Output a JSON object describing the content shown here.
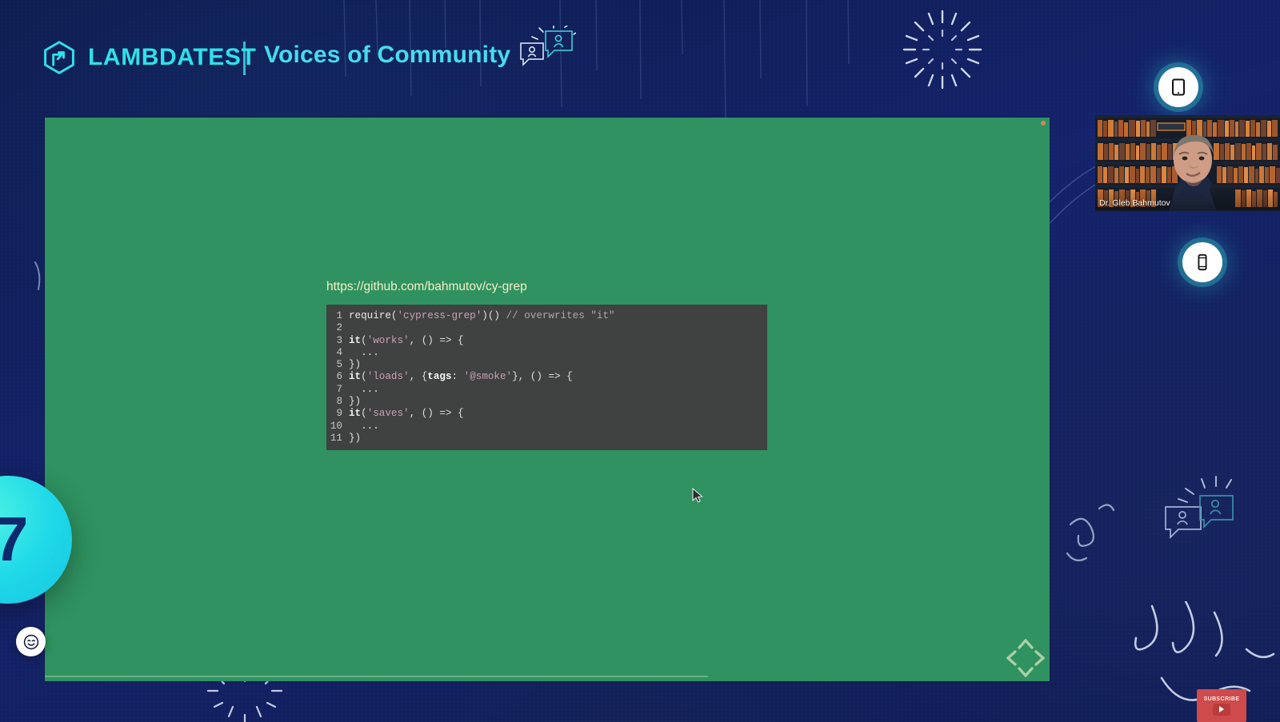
{
  "header": {
    "brand_name": "LAMBDATEST",
    "brand_logo_icon": "lambdatest-hexagon-logo-icon",
    "separator_icon": "vertical-divider-icon",
    "show_title": "Voices of Community",
    "title_icon": "community-speech-bubbles-icon",
    "accent_color": "#2fe1e8",
    "title_color": "#46dcf0",
    "background_color": "#101c4e"
  },
  "decorations": {
    "burst_top_right_icon": "firework-burst-icon",
    "burst_top_left_icon": "firework-burst-icon",
    "burst_bottom_left_icon": "firework-burst-icon",
    "bubbles_right_icon": "community-speech-bubbles-icon",
    "squiggle_right_icon": "squiggle-line-icon",
    "squiggle_bottom_icon": "squiggle-line-icon"
  },
  "device_chips": [
    {
      "name": "tablet-device-chip",
      "icon": "tablet-icon"
    },
    {
      "name": "mobile-device-chip",
      "icon": "mobile-phone-icon"
    }
  ],
  "orb": {
    "name": "teal-accent-orb",
    "glyph": "7",
    "color": "#1fd9e8"
  },
  "reaction_button": {
    "name": "reaction-emoji-button",
    "icon": "smiley-face-icon"
  },
  "subscribe": {
    "label": "SUBSCRIBE",
    "icon": "youtube-play-icon",
    "color": "#cf4a4a"
  },
  "shared_screen": {
    "name": "shared-screen-region",
    "background_color": "#2f9260",
    "fit_icon": "expand-arrows-icon",
    "cursor_icon": "mouse-pointer-icon",
    "recording_dot_color": "#cf8a59",
    "slide": {
      "url": "https://github.com/bahmutov/cy-grep",
      "code_background": "#404141",
      "code_lines": [
        {
          "n": "1",
          "text": "require('cypress-grep')() // overwrites \"it\""
        },
        {
          "n": "2",
          "text": ""
        },
        {
          "n": "3",
          "text": "it('works', () => {"
        },
        {
          "n": "4",
          "text": "  ..."
        },
        {
          "n": "5",
          "text": "})"
        },
        {
          "n": "6",
          "text": "it('loads', {tags: '@smoke'}, () => {"
        },
        {
          "n": "7",
          "text": "  ..."
        },
        {
          "n": "8",
          "text": "})"
        },
        {
          "n": "9",
          "text": "it('saves', () => {"
        },
        {
          "n": "10",
          "text": "  ..."
        },
        {
          "n": "11",
          "text": "})"
        }
      ]
    }
  },
  "webcam": {
    "name": "speaker-video-tile",
    "participant_name": "Dr. Gleb Bahmutov"
  }
}
